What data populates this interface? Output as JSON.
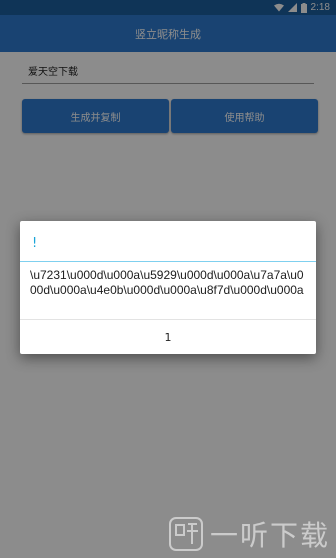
{
  "status_bar": {
    "time": "2:18",
    "icons": [
      "wifi-icon",
      "signal-icon",
      "battery-icon"
    ]
  },
  "app_bar": {
    "title": "竖立昵称生成"
  },
  "form": {
    "input_value": "爱天空下载"
  },
  "buttons": {
    "generate_copy": "生成并复制",
    "help": "使用帮助"
  },
  "dialog": {
    "title": "!",
    "message": "\\u7231\\u000d\\u000a\\u5929\\u000d\\u000a\\u7a7a\\u000d\\u000a\\u4e0b\\u000d\\u000a\\u8f7d\\u000d\\u000a",
    "button": "1"
  },
  "watermark": {
    "text": "一听下载"
  },
  "colors": {
    "primary": "#2f7bd0",
    "status_bar": "#1d5f9f",
    "dialog_accent": "#19a4d8"
  }
}
